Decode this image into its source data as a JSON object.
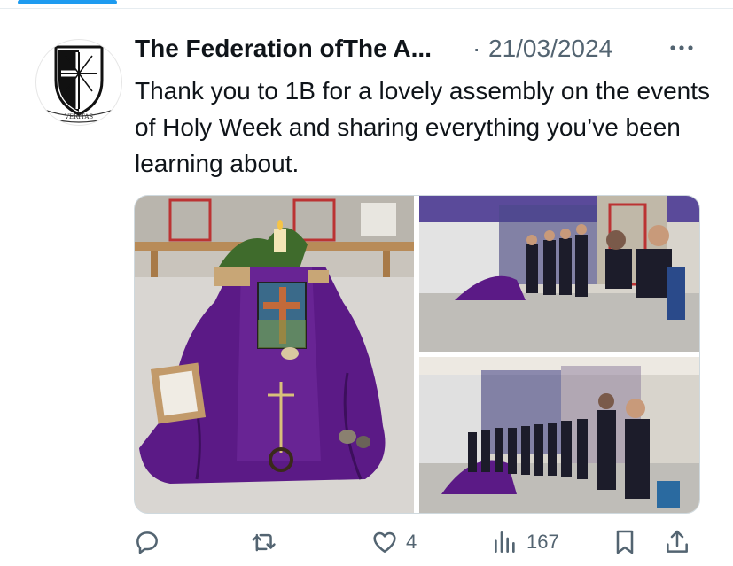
{
  "post": {
    "author_name": "The Federation ofThe A...",
    "separator": "·",
    "date": "21/03/2024",
    "text": "Thank you to 1B for a lovely assembly on the events of Holy Week and sharing everything you’ve been learning about.",
    "avatar_motto": "VERITAS"
  },
  "actions": {
    "reply": {
      "icon": "reply-icon",
      "count": ""
    },
    "repost": {
      "icon": "repost-icon",
      "count": ""
    },
    "like": {
      "icon": "heart-icon",
      "count": "4"
    },
    "views": {
      "icon": "views-icon",
      "count": "167"
    },
    "bookmark": {
      "icon": "bookmark-icon"
    },
    "share": {
      "icon": "share-icon"
    }
  },
  "colors": {
    "accent": "#1d9bf0",
    "text_primary": "#0f1419",
    "text_secondary": "#536471",
    "cloth_purple": "#5b1a86"
  }
}
